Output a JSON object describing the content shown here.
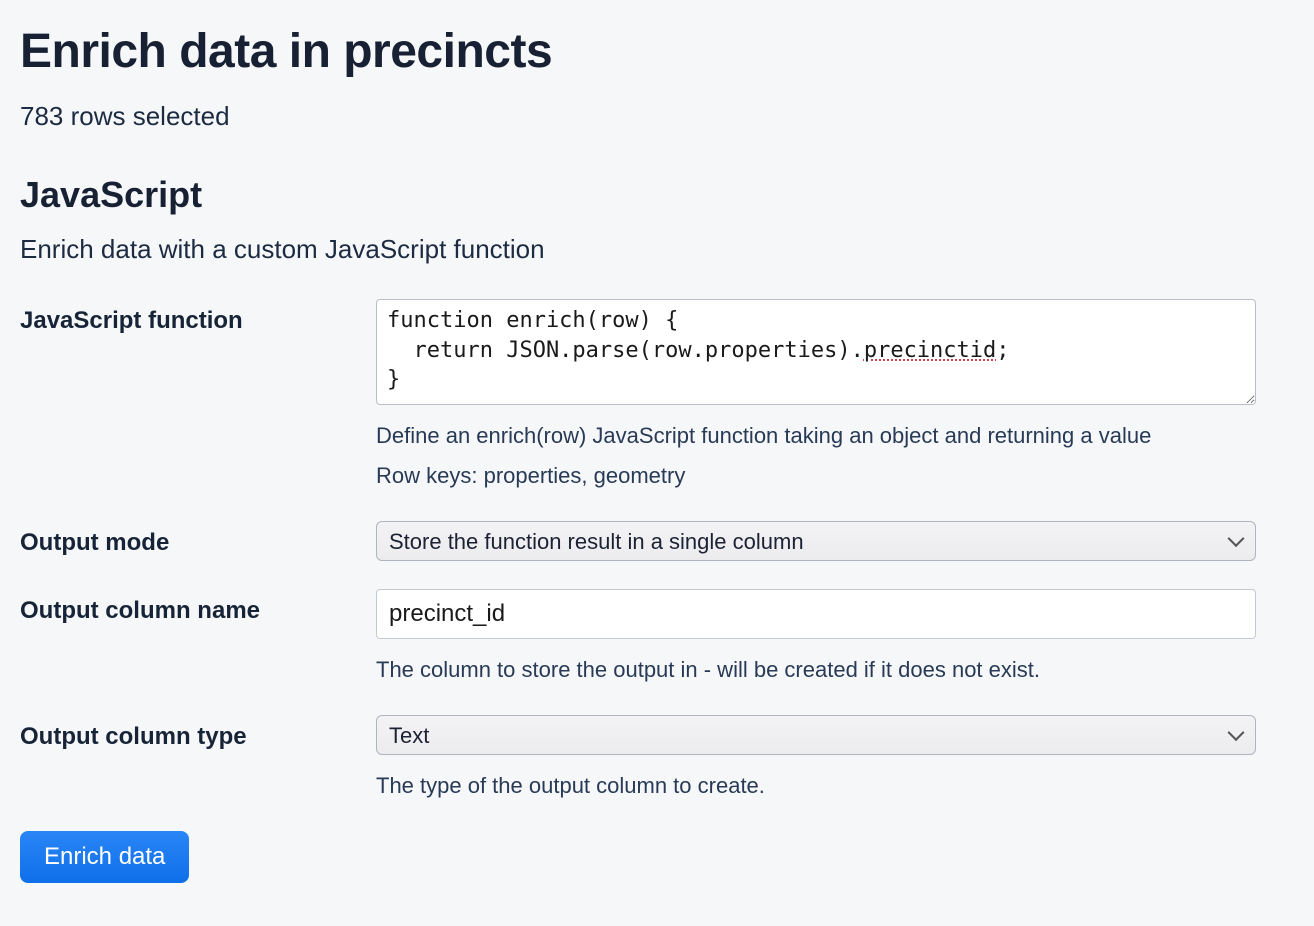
{
  "page": {
    "title": "Enrich data in precincts",
    "rows_selected_text": "783 rows selected"
  },
  "section": {
    "title": "JavaScript",
    "description": "Enrich data with a custom JavaScript function"
  },
  "fields": {
    "js_function": {
      "label": "JavaScript function",
      "code_line1": "function enrich(row) {",
      "code_line2_pre": "  return JSON.parse(row.properties).",
      "code_line2_spell": "precinctid",
      "code_line2_post": ";",
      "code_line3": "}",
      "help_line1": "Define an enrich(row) JavaScript function taking an object and returning a value",
      "help_line2": "Row keys: properties, geometry"
    },
    "output_mode": {
      "label": "Output mode",
      "selected": "Store the function result in a single column"
    },
    "output_column_name": {
      "label": "Output column name",
      "value": "precinct_id",
      "help": "The column to store the output in - will be created if it does not exist."
    },
    "output_column_type": {
      "label": "Output column type",
      "selected": "Text",
      "help": "The type of the output column to create."
    }
  },
  "buttons": {
    "submit": "Enrich data"
  }
}
